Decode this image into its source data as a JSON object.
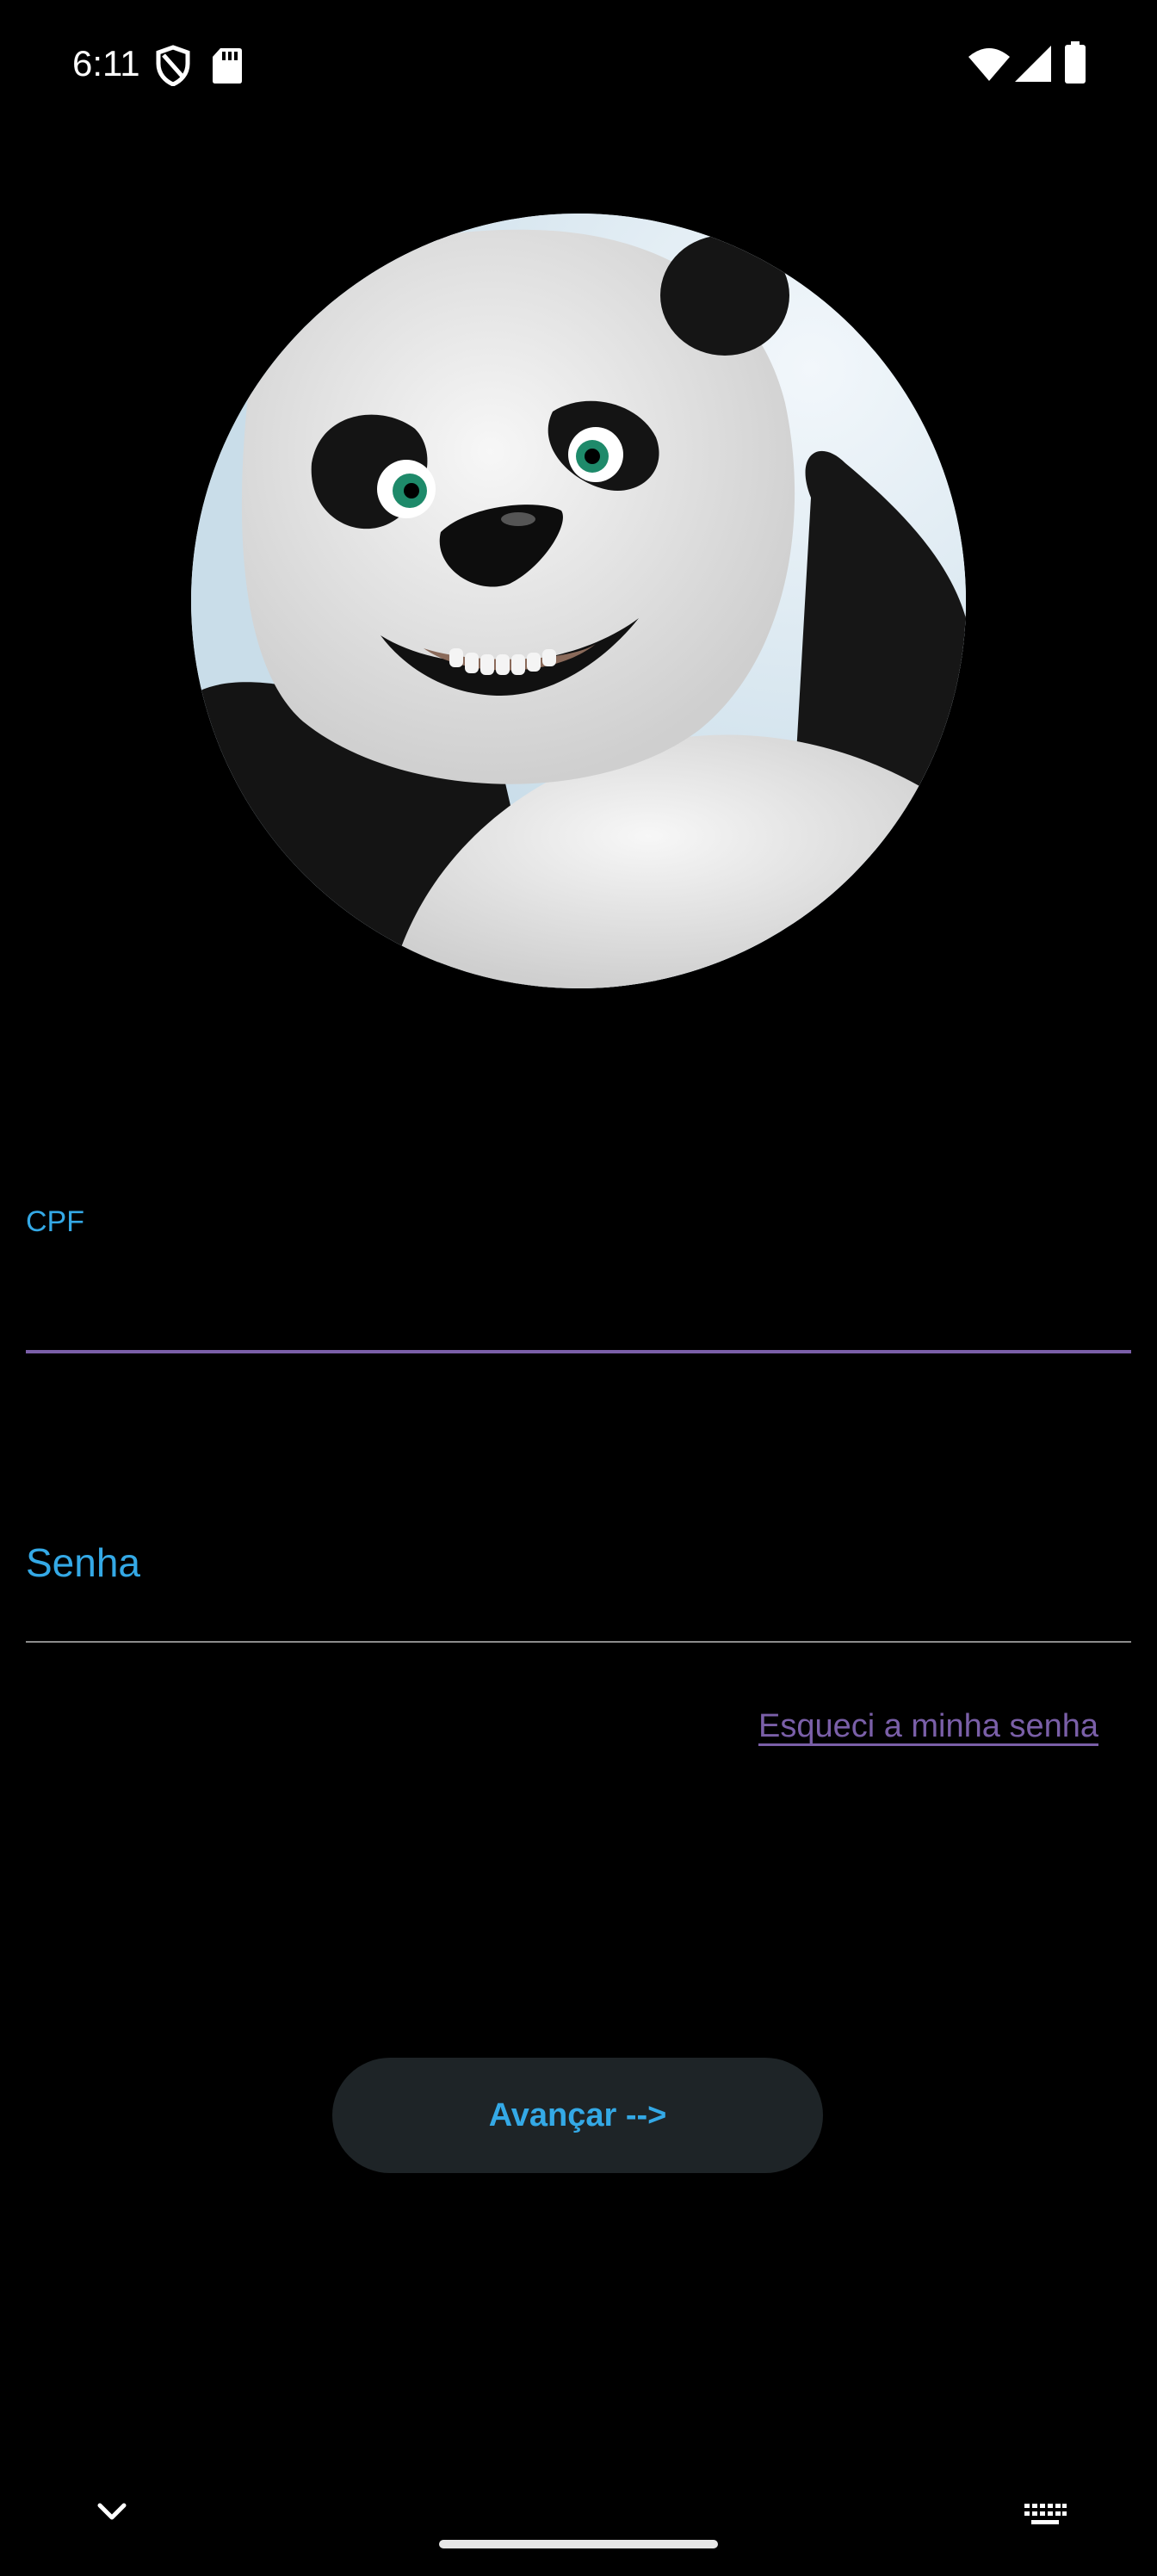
{
  "status_bar": {
    "time": "6:11",
    "icons": [
      "shield-icon",
      "sd-card-icon",
      "wifi-icon",
      "signal-icon",
      "battery-icon"
    ]
  },
  "avatar": {
    "icon": "panda-avatar",
    "colors": {
      "sky": "#dfeaf2",
      "fur_white": "#ececec",
      "fur_black": "#151515",
      "eye": "#1e8a6a"
    }
  },
  "form": {
    "cpf": {
      "label": "CPF",
      "value": ""
    },
    "senha": {
      "label": "Senha",
      "value": ""
    },
    "forgot_link": "Esqueci a minha senha",
    "submit_label": "Avançar -->"
  },
  "nav": {
    "icons": [
      "chevron-down-icon",
      "keyboard-icon"
    ]
  },
  "colors": {
    "background": "#000000",
    "accent_blue": "#34a9e6",
    "accent_purple": "#7a5fa8",
    "button_bg": "#1e2427"
  }
}
